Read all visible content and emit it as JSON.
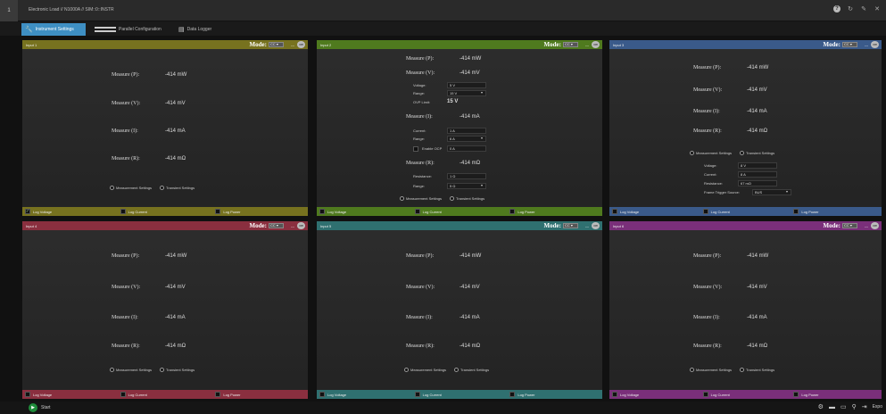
{
  "window": {
    "number": "1",
    "title": "Electronic Load // N1000A // SIM::0::INSTR",
    "icons": [
      "help-icon",
      "refresh-icon",
      "edit-icon",
      "close-icon"
    ]
  },
  "tabs": [
    {
      "label": "Instrument Settings",
      "icon": "wrench-icon",
      "active": true
    },
    {
      "label": "Parallel Configuration",
      "icon": "cable-icon",
      "active": false
    },
    {
      "label": "Data Logger",
      "icon": "database-icon",
      "active": false
    }
  ],
  "common": {
    "mode_label": "Mode:",
    "mode_value": "CC ▾",
    "dash": "---",
    "onoff": "Off",
    "measurement_settings": "Measurement Settings",
    "transient_settings": "Transient Settings",
    "log_voltage": "Log Voltage",
    "log_current": "Log Current",
    "log_power": "Log Power",
    "measure_p": "Measure (P):",
    "measure_v": "Measure (V):",
    "measure_i": "Measure (I):",
    "measure_r": "Measure (R):",
    "value_p": "-414 mW",
    "value_v": "-414 mV",
    "value_i": "-414 mA",
    "value_r": "-414 mΩ"
  },
  "panels": [
    {
      "name": "Input 1",
      "color": "#77721f",
      "foot_color": "#77721f",
      "log_voltage_checked": true
    },
    {
      "name": "Input 2",
      "color": "#4f7a1e",
      "foot_color": "#4f7a1e",
      "log_voltage_checked": false
    },
    {
      "name": "Input 3",
      "color": "#3a5a8a",
      "foot_color": "#3a5a8a",
      "log_voltage_checked": false
    },
    {
      "name": "Input 4",
      "color": "#8a2f3f",
      "foot_color": "#8a2f3f",
      "log_voltage_checked": false
    },
    {
      "name": "Input 5",
      "color": "#2f7070",
      "foot_color": "#2f7070",
      "log_voltage_checked": false
    },
    {
      "name": "Input 6",
      "color": "#7a2f7a",
      "foot_color": "#7a2f7a",
      "log_voltage_checked": false
    }
  ],
  "input2": {
    "voltage_label": "Voltage:",
    "voltage_value": "5 V",
    "range_label": "Range:",
    "vrange_value": "15 V",
    "ovp_label": "OVP Limit:",
    "ovp_value": "15 V",
    "current_label": "Current:",
    "current_value": "1 A",
    "irange_value": "6 A",
    "ocp_label": "Enable OCP",
    "ocp_value": "0 A",
    "resistance_label": "Resistance:",
    "resistance_value": "1 Ω",
    "rrange_value": "5 Ω"
  },
  "input3": {
    "voltage_label": "Voltage:",
    "voltage_value": "8 V",
    "current_label": "Current:",
    "current_value": "8 A",
    "resistance_label": "Resistance:",
    "resistance_value": "67 mΩ",
    "trigger_label": "Frame Trigger Source:",
    "trigger_value": "BUS"
  },
  "status": {
    "start_label": "Start",
    "export_label": "Expo",
    "icons": [
      "settings-icon",
      "save-icon",
      "open-folder-icon",
      "pin-icon",
      "export-icon"
    ]
  }
}
